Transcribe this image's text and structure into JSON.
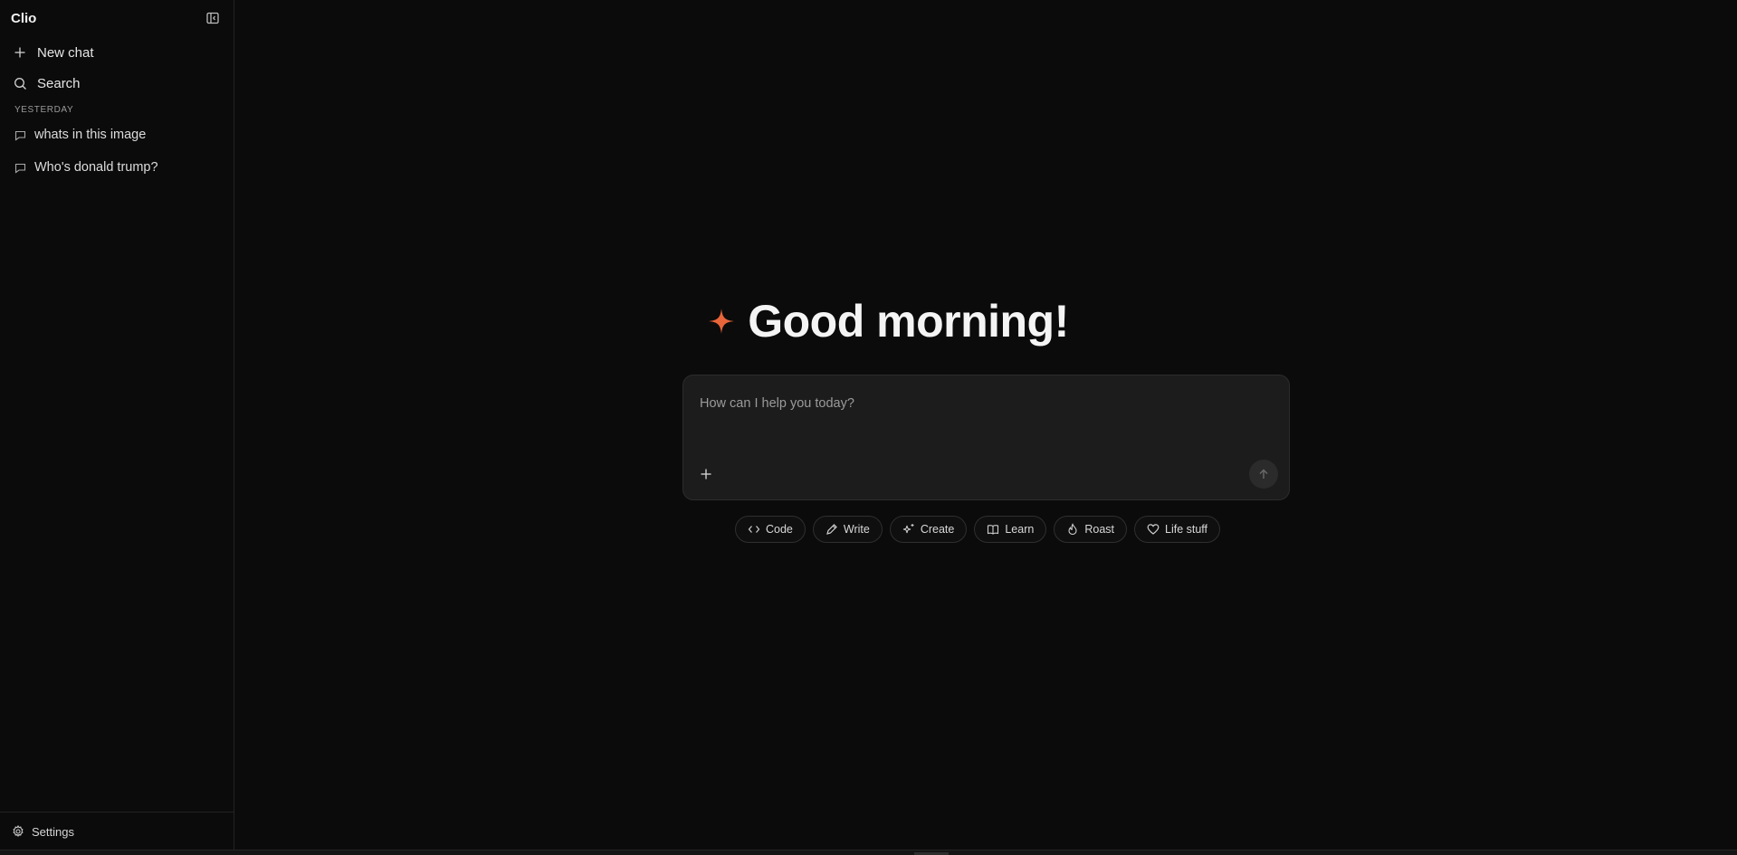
{
  "app": {
    "brand": "Clio"
  },
  "sidebar": {
    "nav": [
      {
        "label": "New chat",
        "icon": "plus-icon"
      },
      {
        "label": "Search",
        "icon": "search-icon"
      }
    ],
    "section_label": "YESTERDAY",
    "chats": [
      {
        "label": "whats in this image",
        "icon": "chat-bubble-icon"
      },
      {
        "label": "Who's donald trump?",
        "icon": "chat-bubble-icon"
      }
    ],
    "footer": {
      "label": "Settings",
      "icon": "gear-icon"
    }
  },
  "main": {
    "greeting": "Good morning!",
    "composer": {
      "placeholder": "How can I help you today?",
      "value": ""
    },
    "chips": [
      {
        "label": "Code",
        "icon": "code-icon"
      },
      {
        "label": "Write",
        "icon": "pen-icon"
      },
      {
        "label": "Create",
        "icon": "sparkles-icon"
      },
      {
        "label": "Learn",
        "icon": "book-icon"
      },
      {
        "label": "Roast",
        "icon": "flame-icon"
      },
      {
        "label": "Life stuff",
        "icon": "heart-icon"
      }
    ]
  },
  "colors": {
    "background": "#0b0b0b",
    "accent": "#e8653a",
    "composer_bg": "#1c1c1c",
    "text": "#e6e6e6"
  }
}
